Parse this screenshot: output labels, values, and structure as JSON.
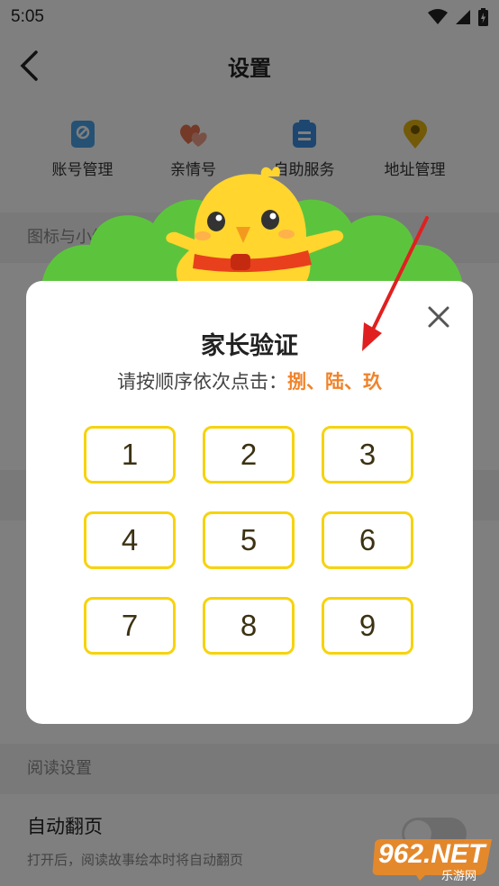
{
  "status_bar": {
    "time": "5:05"
  },
  "nav": {
    "title": "设置"
  },
  "quick_links": [
    {
      "label": "账号管理",
      "icon": "account-icon",
      "color": "#4aa3e8"
    },
    {
      "label": "亲情号",
      "icon": "hearts-icon",
      "color": "#e8734f"
    },
    {
      "label": "自助服务",
      "icon": "clipboard-icon",
      "color": "#3b8fe0"
    },
    {
      "label": "地址管理",
      "icon": "location-pin-icon",
      "color": "#e6b412"
    }
  ],
  "sections": {
    "widgets_label": "图标与小组件",
    "reading_label": "阅读设置"
  },
  "auto_page": {
    "title": "自动翻页",
    "subtitle": "打开后，阅读故事绘本时将自动翻页"
  },
  "dialog": {
    "title": "家长验证",
    "instruction": "请按顺序依次点击：",
    "sequence": "捌、陆、玖",
    "keys": [
      "1",
      "2",
      "3",
      "4",
      "5",
      "6",
      "7",
      "8",
      "9"
    ]
  },
  "watermark": {
    "brand": "962.NET",
    "sub": "乐游网"
  },
  "colors": {
    "accent": "#f0832a",
    "key_border": "#f6d30e",
    "bush": "#5cc43c",
    "mascot": "#ffd52e",
    "arrow": "#e02020"
  }
}
